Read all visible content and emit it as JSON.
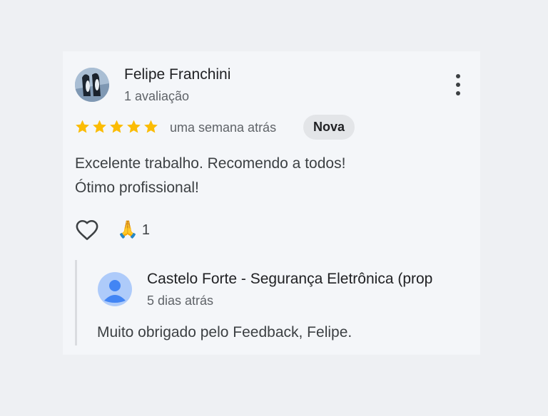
{
  "review": {
    "author_name": "Felipe Franchini",
    "author_review_count": "1 avaliação",
    "rating": 5,
    "rating_max": 5,
    "star_color": "#fbbc04",
    "time": "uma semana atrás",
    "badge": "Nova",
    "text_lines": [
      "Excelente trabalho. Recomendo a todos!",
      "Ótimo profissional!"
    ],
    "reaction_emoji": "🙏",
    "reaction_count": "1",
    "icons": {
      "more": "more-vertical-icon",
      "like": "heart-outline-icon",
      "star": "star-icon"
    }
  },
  "owner_reply": {
    "name": "Castelo Forte - Segurança Eletrônica (prop",
    "time": "5 dias atrás",
    "text": "Muito obrigado pelo Feedback, Felipe.",
    "avatar_color": "#aecbfa",
    "avatar_person_color": "#4285f4"
  }
}
